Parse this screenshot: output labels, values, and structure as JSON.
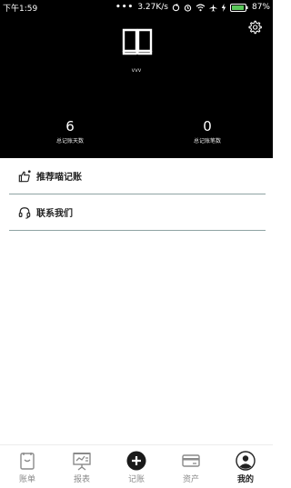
{
  "status_bar": {
    "time": "下午1:59",
    "network_speed": "3.27K/s",
    "battery": "87%"
  },
  "profile": {
    "username": "vvv",
    "stats": [
      {
        "value": "6",
        "label": "总记账天数"
      },
      {
        "value": "0",
        "label": "总记账笔数"
      }
    ]
  },
  "menu": {
    "items": [
      {
        "label": "推荐喵记账",
        "icon": "thumbs-up-icon"
      },
      {
        "label": "联系我们",
        "icon": "headset-icon"
      }
    ]
  },
  "tabbar": {
    "tabs": [
      {
        "label": "账单",
        "icon": "ledger-icon"
      },
      {
        "label": "报表",
        "icon": "report-icon"
      },
      {
        "label": "记账",
        "icon": "add-icon"
      },
      {
        "label": "资产",
        "icon": "card-icon"
      },
      {
        "label": "我的",
        "icon": "profile-icon"
      }
    ],
    "active": "我的"
  },
  "colors": {
    "header_bg": "#000000",
    "divider": "#8fa3a3",
    "tab_inactive": "#8a8a8a",
    "battery_green": "#5ac85a"
  }
}
